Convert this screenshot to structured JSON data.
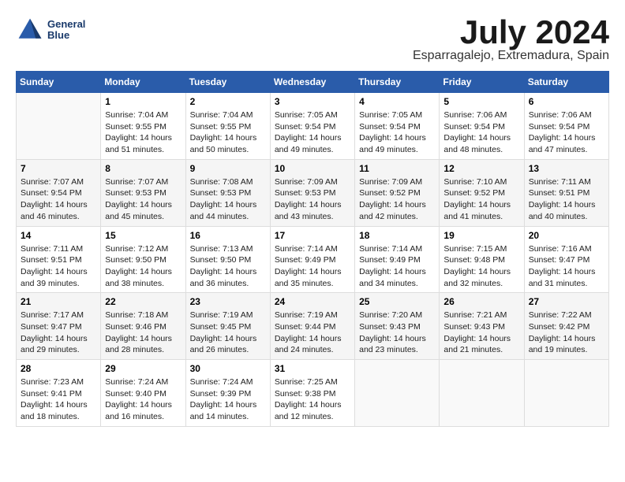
{
  "logo": {
    "line1": "General",
    "line2": "Blue"
  },
  "title": "July 2024",
  "location": "Esparragalejo, Extremadura, Spain",
  "days_header": [
    "Sunday",
    "Monday",
    "Tuesday",
    "Wednesday",
    "Thursday",
    "Friday",
    "Saturday"
  ],
  "weeks": [
    [
      {
        "day": "",
        "info": ""
      },
      {
        "day": "1",
        "info": "Sunrise: 7:04 AM\nSunset: 9:55 PM\nDaylight: 14 hours\nand 51 minutes."
      },
      {
        "day": "2",
        "info": "Sunrise: 7:04 AM\nSunset: 9:55 PM\nDaylight: 14 hours\nand 50 minutes."
      },
      {
        "day": "3",
        "info": "Sunrise: 7:05 AM\nSunset: 9:54 PM\nDaylight: 14 hours\nand 49 minutes."
      },
      {
        "day": "4",
        "info": "Sunrise: 7:05 AM\nSunset: 9:54 PM\nDaylight: 14 hours\nand 49 minutes."
      },
      {
        "day": "5",
        "info": "Sunrise: 7:06 AM\nSunset: 9:54 PM\nDaylight: 14 hours\nand 48 minutes."
      },
      {
        "day": "6",
        "info": "Sunrise: 7:06 AM\nSunset: 9:54 PM\nDaylight: 14 hours\nand 47 minutes."
      }
    ],
    [
      {
        "day": "7",
        "info": "Sunrise: 7:07 AM\nSunset: 9:54 PM\nDaylight: 14 hours\nand 46 minutes."
      },
      {
        "day": "8",
        "info": "Sunrise: 7:07 AM\nSunset: 9:53 PM\nDaylight: 14 hours\nand 45 minutes."
      },
      {
        "day": "9",
        "info": "Sunrise: 7:08 AM\nSunset: 9:53 PM\nDaylight: 14 hours\nand 44 minutes."
      },
      {
        "day": "10",
        "info": "Sunrise: 7:09 AM\nSunset: 9:53 PM\nDaylight: 14 hours\nand 43 minutes."
      },
      {
        "day": "11",
        "info": "Sunrise: 7:09 AM\nSunset: 9:52 PM\nDaylight: 14 hours\nand 42 minutes."
      },
      {
        "day": "12",
        "info": "Sunrise: 7:10 AM\nSunset: 9:52 PM\nDaylight: 14 hours\nand 41 minutes."
      },
      {
        "day": "13",
        "info": "Sunrise: 7:11 AM\nSunset: 9:51 PM\nDaylight: 14 hours\nand 40 minutes."
      }
    ],
    [
      {
        "day": "14",
        "info": "Sunrise: 7:11 AM\nSunset: 9:51 PM\nDaylight: 14 hours\nand 39 minutes."
      },
      {
        "day": "15",
        "info": "Sunrise: 7:12 AM\nSunset: 9:50 PM\nDaylight: 14 hours\nand 38 minutes."
      },
      {
        "day": "16",
        "info": "Sunrise: 7:13 AM\nSunset: 9:50 PM\nDaylight: 14 hours\nand 36 minutes."
      },
      {
        "day": "17",
        "info": "Sunrise: 7:14 AM\nSunset: 9:49 PM\nDaylight: 14 hours\nand 35 minutes."
      },
      {
        "day": "18",
        "info": "Sunrise: 7:14 AM\nSunset: 9:49 PM\nDaylight: 14 hours\nand 34 minutes."
      },
      {
        "day": "19",
        "info": "Sunrise: 7:15 AM\nSunset: 9:48 PM\nDaylight: 14 hours\nand 32 minutes."
      },
      {
        "day": "20",
        "info": "Sunrise: 7:16 AM\nSunset: 9:47 PM\nDaylight: 14 hours\nand 31 minutes."
      }
    ],
    [
      {
        "day": "21",
        "info": "Sunrise: 7:17 AM\nSunset: 9:47 PM\nDaylight: 14 hours\nand 29 minutes."
      },
      {
        "day": "22",
        "info": "Sunrise: 7:18 AM\nSunset: 9:46 PM\nDaylight: 14 hours\nand 28 minutes."
      },
      {
        "day": "23",
        "info": "Sunrise: 7:19 AM\nSunset: 9:45 PM\nDaylight: 14 hours\nand 26 minutes."
      },
      {
        "day": "24",
        "info": "Sunrise: 7:19 AM\nSunset: 9:44 PM\nDaylight: 14 hours\nand 24 minutes."
      },
      {
        "day": "25",
        "info": "Sunrise: 7:20 AM\nSunset: 9:43 PM\nDaylight: 14 hours\nand 23 minutes."
      },
      {
        "day": "26",
        "info": "Sunrise: 7:21 AM\nSunset: 9:43 PM\nDaylight: 14 hours\nand 21 minutes."
      },
      {
        "day": "27",
        "info": "Sunrise: 7:22 AM\nSunset: 9:42 PM\nDaylight: 14 hours\nand 19 minutes."
      }
    ],
    [
      {
        "day": "28",
        "info": "Sunrise: 7:23 AM\nSunset: 9:41 PM\nDaylight: 14 hours\nand 18 minutes."
      },
      {
        "day": "29",
        "info": "Sunrise: 7:24 AM\nSunset: 9:40 PM\nDaylight: 14 hours\nand 16 minutes."
      },
      {
        "day": "30",
        "info": "Sunrise: 7:24 AM\nSunset: 9:39 PM\nDaylight: 14 hours\nand 14 minutes."
      },
      {
        "day": "31",
        "info": "Sunrise: 7:25 AM\nSunset: 9:38 PM\nDaylight: 14 hours\nand 12 minutes."
      },
      {
        "day": "",
        "info": ""
      },
      {
        "day": "",
        "info": ""
      },
      {
        "day": "",
        "info": ""
      }
    ]
  ]
}
